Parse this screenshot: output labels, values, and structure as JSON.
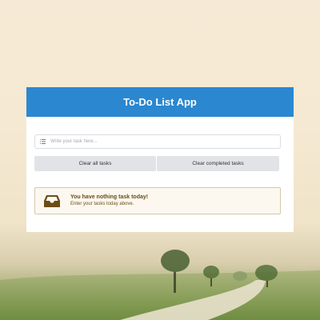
{
  "app": {
    "title": "To-Do List App",
    "input": {
      "placeholder": "Write your task here...",
      "icon": "list-icon"
    },
    "buttons": {
      "clear_all": "Clear all tasks",
      "clear_completed": "Clear completed tasks"
    },
    "empty_state": {
      "icon": "inbox-icon",
      "title": "You have nothing task today!",
      "subtitle": "Enter your tasks today above."
    }
  },
  "colors": {
    "header": "#2a87d0",
    "button_bg": "#e2e3e6",
    "notice_bg": "#fcf8f0",
    "notice_text": "#6b4e16"
  }
}
